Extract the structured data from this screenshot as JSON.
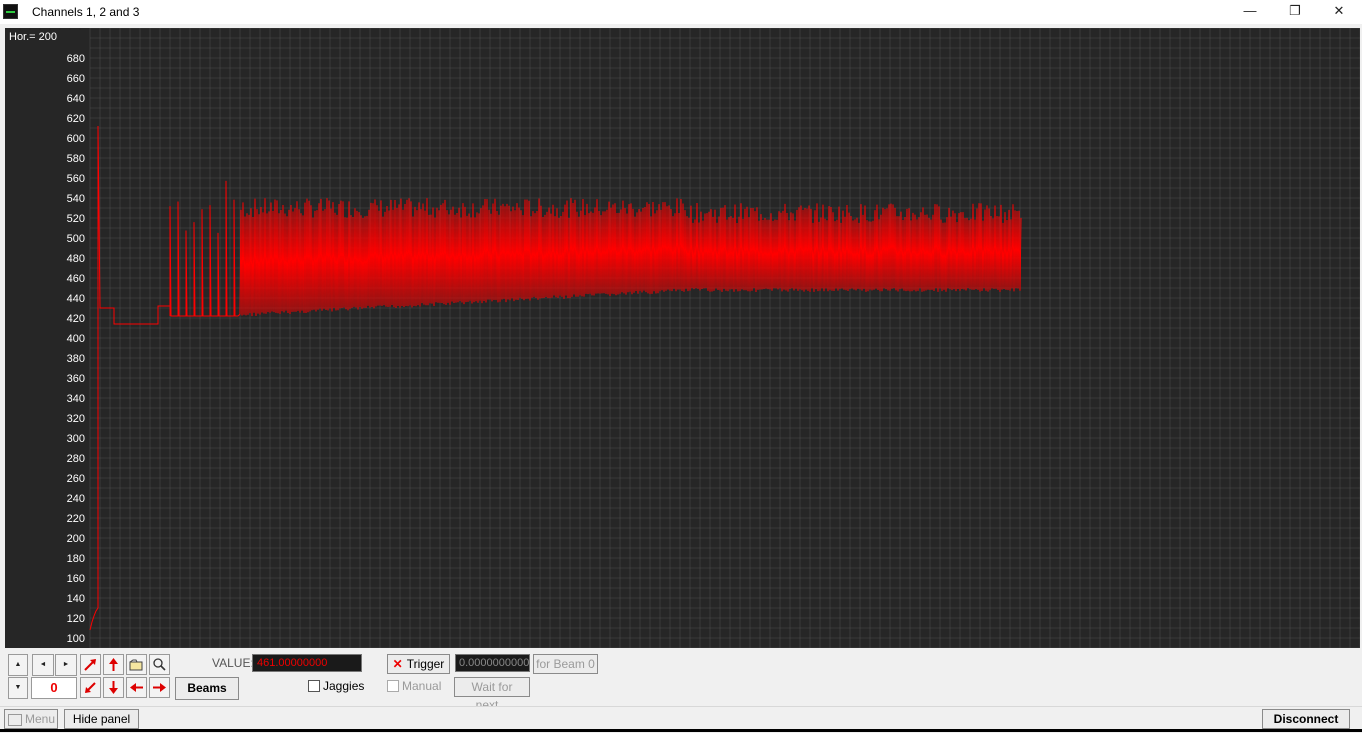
{
  "window": {
    "title": "Channels 1, 2 and 3"
  },
  "window_controls": {
    "minimize": "—",
    "restore": "❐",
    "close": "✕"
  },
  "scope": {
    "hor_label": "Hor.= 200",
    "y_ticks": [
      "680",
      "660",
      "640",
      "620",
      "600",
      "580",
      "560",
      "540",
      "520",
      "500",
      "480",
      "460",
      "440",
      "420",
      "400",
      "380",
      "360",
      "340",
      "320",
      "300",
      "280",
      "260",
      "240",
      "220",
      "200",
      "180",
      "160",
      "140",
      "120",
      "100"
    ],
    "trace_color": "#ff0000",
    "background": "#262626",
    "grid_color": "#4a4a4a"
  },
  "chart_data": {
    "type": "line",
    "title": "",
    "xlabel": "",
    "ylabel": "",
    "ylim": [
      100,
      680
    ],
    "grid": true,
    "series": [
      {
        "color": "#ff0000",
        "segments": [
          {
            "from_sample": 0,
            "to_sample": 4,
            "values": [
              108,
              116,
              122,
              127,
              130
            ]
          },
          {
            "spike_sample": 4,
            "peak": 612
          },
          {
            "from_sample": 5,
            "to_sample": 12,
            "level": 430
          },
          {
            "from_sample": 12,
            "to_sample": 34,
            "level": 414
          },
          {
            "from_sample": 34,
            "to_sample": 40,
            "level": 432
          },
          {
            "from_sample": 40,
            "to_sample": 75,
            "baseline": 422,
            "spike_range": [
              500,
              565
            ]
          },
          {
            "from_sample": 75,
            "to_sample": 300,
            "baseline_start": 425,
            "baseline_end": 450,
            "band_top": [
              520,
              540
            ]
          },
          {
            "from_sample": 300,
            "to_sample": 466,
            "baseline": 450,
            "band_top": [
              515,
              535
            ]
          }
        ]
      }
    ]
  },
  "controls": {
    "up_arrow": "▲",
    "down_arrow": "▼",
    "left_arrow": "◄",
    "right_arrow": "►",
    "beam_number": "0",
    "beams_label": "Beams",
    "value_label": "VALUE:",
    "value": "461.00000000",
    "jaggies_label": "Jaggies",
    "trigger_label": "Trigger",
    "trigger_value": "0.0000000000",
    "for_beam_label": "for Beam 0",
    "manual_label": "Manual",
    "wait_label": "Wait for next..."
  },
  "status": {
    "menu_label": "Menu",
    "hide_panel_label": "Hide panel",
    "disconnect_label": "Disconnect"
  }
}
